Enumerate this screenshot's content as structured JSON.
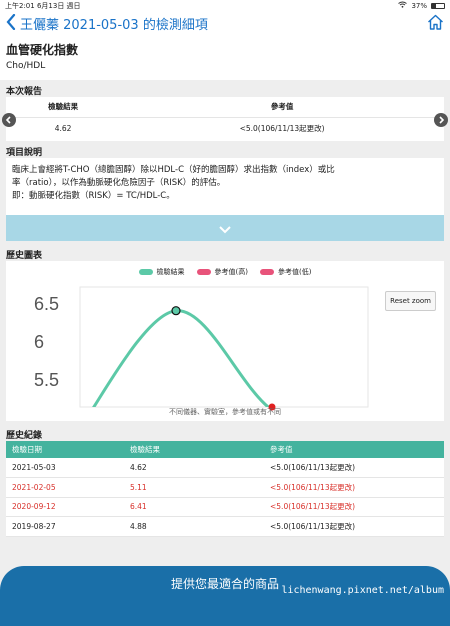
{
  "status": {
    "time": "上午2:01",
    "date": "6月13日 週日",
    "battery": "37%",
    "battery_level": 0.37
  },
  "nav": {
    "title": "王儷蓁 2021-05-03 的檢測細項",
    "back_icon": "chevron-left-icon",
    "home_icon": "home-icon"
  },
  "test": {
    "name": "血管硬化指數",
    "code": "Cho/HDL"
  },
  "report": {
    "section_title": "本次報告",
    "headers": [
      "檢驗結果",
      "參考值"
    ],
    "result": "4.62",
    "reference": "<5.0(106/11/13起更改)"
  },
  "description": {
    "section_title": "項目說明",
    "lines": [
      "臨床上會經將T-CHO（總膽固醇）除以HDL-C（好的膽固醇）求出指數（index）或比",
      "率（ratio），以作為動脈硬化危險因子（RISK）的評估。",
      "即：動脈硬化指數（RISK）= TC/HDL-C。"
    ]
  },
  "history_chart": {
    "section_title": "歷史圖表",
    "reset_label": "Reset zoom",
    "note": "不同儀器、實驗室，參考值或有不同"
  },
  "chart_data": {
    "type": "line",
    "series": [
      {
        "name": "檢驗結果",
        "color": "#5cc9a7"
      },
      {
        "name": "參考值(高)",
        "color": "#e8537a"
      },
      {
        "name": "參考值(低)",
        "color": "#e8537a"
      }
    ],
    "yticks": [
      6.5,
      6,
      5.5
    ],
    "ylim": [
      5.15,
      6.72
    ],
    "x": [
      "2019-08-27",
      "2020-09-12",
      "2021-02-05",
      "2021-05-03"
    ],
    "values": [
      4.88,
      6.41,
      5.11,
      4.62
    ],
    "grid": false
  },
  "history": {
    "section_title": "歷史紀錄",
    "headers": [
      "檢驗日期",
      "檢驗結果",
      "參考值"
    ],
    "rows": [
      {
        "date": "2021-05-03",
        "result": "4.62",
        "ref": "<5.0(106/11/13起更改)",
        "red": false
      },
      {
        "date": "2021-02-05",
        "result": "5.11",
        "ref": "<5.0(106/11/13起更改)",
        "red": true
      },
      {
        "date": "2020-09-12",
        "result": "6.41",
        "ref": "<5.0(106/11/13起更改)",
        "red": true
      },
      {
        "date": "2019-08-27",
        "result": "4.88",
        "ref": "<5.0(106/11/13起更改)",
        "red": false
      }
    ]
  },
  "bottom_button": "提供您最適合的商品",
  "watermark": "lichenwang.pixnet.net/album"
}
